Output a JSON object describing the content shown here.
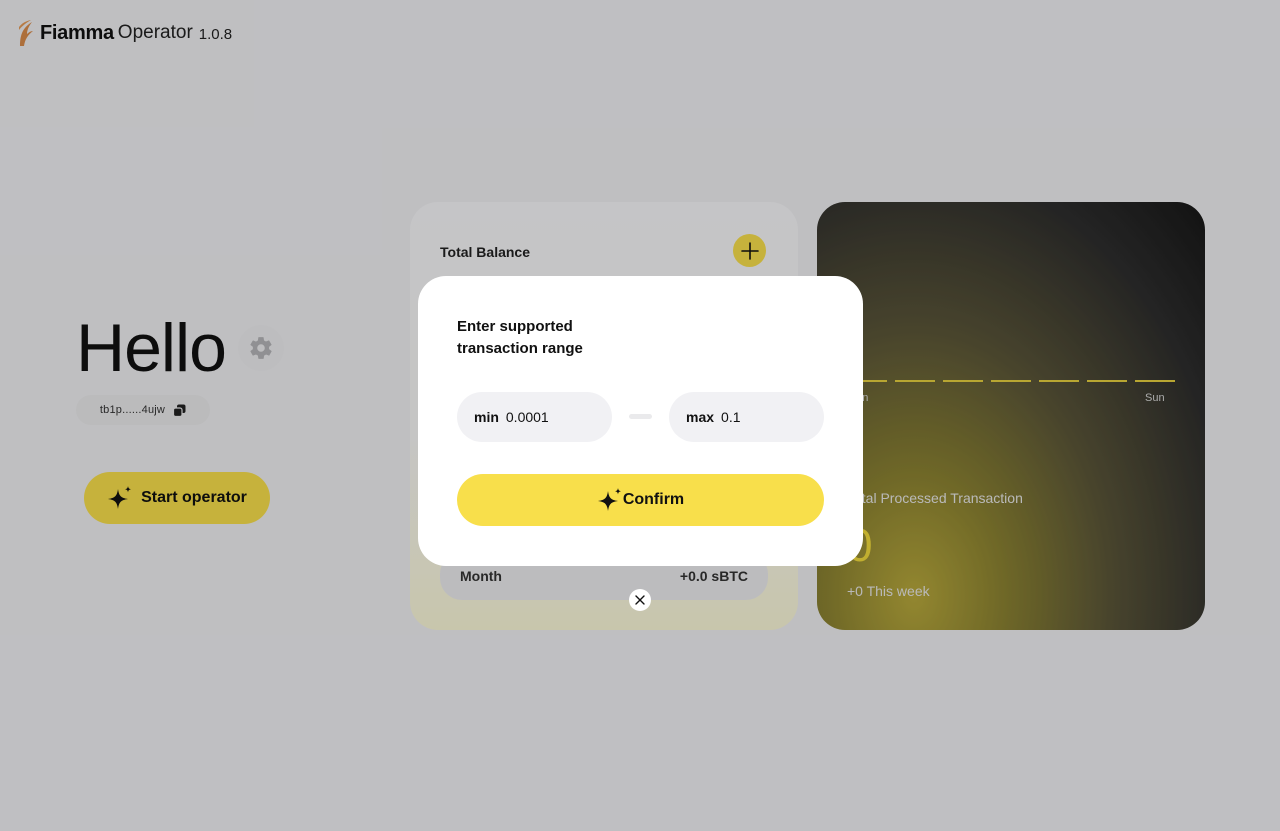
{
  "header": {
    "brand_name": "Fiamma",
    "brand_suffix": "Operator",
    "version": "1.0.8",
    "logo_icon": "flame-logo-icon"
  },
  "hero": {
    "greeting": "Hello",
    "settings_icon": "gear-icon",
    "address": "tb1p......4ujw",
    "copy_icon": "copy-icon",
    "start_button_label": "Start operator",
    "start_button_icon": "sparkle-icon"
  },
  "balance_card": {
    "title": "Total Balance",
    "add_icon": "plus-icon",
    "month_label": "Month",
    "month_value": "+0.0 sBTC"
  },
  "stats_card": {
    "days": [
      "Mon",
      "",
      "",
      "",
      "",
      "",
      "Sun"
    ],
    "title": "Total Processed Transaction",
    "value": "0",
    "week_change": "+0 This week"
  },
  "modal": {
    "title": "Enter supported transaction range",
    "min_label": "min",
    "min_value": "0.0001",
    "max_label": "max",
    "max_value": "0.1",
    "confirm_label": "Confirm",
    "confirm_icon": "sparkle-icon",
    "close_icon": "close-icon"
  },
  "colors": {
    "accent": "#f8df4b",
    "background": "#efeff2",
    "card_dark": "#171717",
    "text_primary": "#111111"
  }
}
